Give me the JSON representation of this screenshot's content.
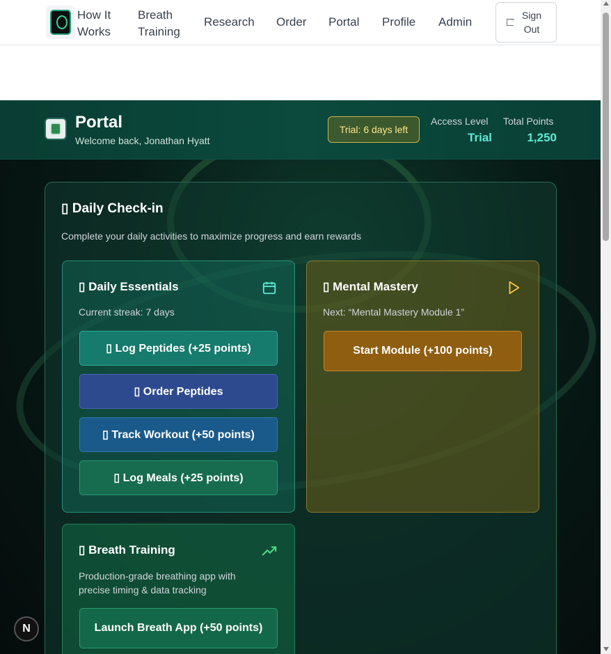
{
  "nav": {
    "items": [
      {
        "label_line1": "How It",
        "label_line2": "Works"
      },
      {
        "label_line1": "Breath",
        "label_line2": "Training"
      },
      {
        "label": "Research"
      },
      {
        "label": "Order"
      },
      {
        "label": "Portal"
      },
      {
        "label": "Profile"
      },
      {
        "label": "Admin"
      }
    ],
    "signout_line1": "Sign",
    "signout_line2": "Out"
  },
  "portal": {
    "title": "Portal",
    "welcome": "Welcome back, Jonathan Hyatt",
    "trial_badge": "Trial: 6 days left",
    "access_label": "Access Level",
    "access_value": "Trial",
    "points_label": "Total Points",
    "points_value": "1,250"
  },
  "checkin": {
    "title": "▯ Daily Check-in",
    "subtitle": "Complete your daily activities to maximize progress and earn rewards",
    "essentials": {
      "title": "▯ Daily Essentials",
      "streak": "Current streak: 7 days",
      "buttons": [
        "▯ Log Peptides (+25 points)",
        "▯ Order Peptides",
        "▯ Track Workout (+50 points)",
        "▯ Log Meals (+25 points)"
      ]
    },
    "mental": {
      "title": "▯ Mental Mastery",
      "next": "Next: “Mental Mastery Module 1”",
      "button": "Start Module (+100 points)"
    },
    "breath": {
      "title": "▯ Breath Training",
      "desc_line1": "Production-grade breathing app with",
      "desc_line2": "precise timing & data tracking",
      "button": "Launch Breath App (+50 points)"
    }
  },
  "next_badge": "N",
  "colors": {
    "accent_teal": "#5eead4",
    "trial_yellow": "#fde68a",
    "mental_gold": "#f5c542"
  },
  "icons": [
    "calendar-icon",
    "play-icon",
    "trending-up-icon",
    "sign-out-icon"
  ]
}
